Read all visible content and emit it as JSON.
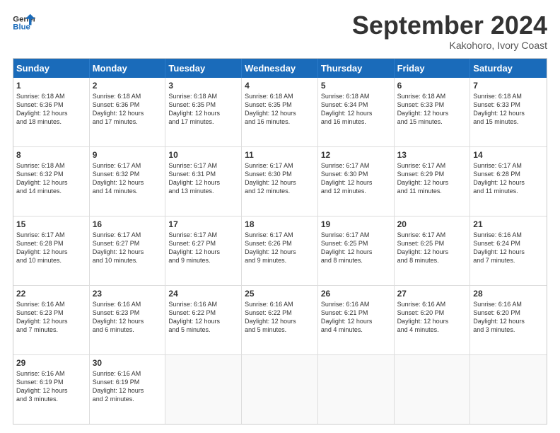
{
  "header": {
    "logo_line1": "General",
    "logo_line2": "Blue",
    "month": "September 2024",
    "location": "Kakohoro, Ivory Coast"
  },
  "weekdays": [
    "Sunday",
    "Monday",
    "Tuesday",
    "Wednesday",
    "Thursday",
    "Friday",
    "Saturday"
  ],
  "weeks": [
    [
      {
        "day": "1",
        "lines": [
          "Sunrise: 6:18 AM",
          "Sunset: 6:36 PM",
          "Daylight: 12 hours",
          "and 18 minutes."
        ]
      },
      {
        "day": "2",
        "lines": [
          "Sunrise: 6:18 AM",
          "Sunset: 6:36 PM",
          "Daylight: 12 hours",
          "and 17 minutes."
        ]
      },
      {
        "day": "3",
        "lines": [
          "Sunrise: 6:18 AM",
          "Sunset: 6:35 PM",
          "Daylight: 12 hours",
          "and 17 minutes."
        ]
      },
      {
        "day": "4",
        "lines": [
          "Sunrise: 6:18 AM",
          "Sunset: 6:35 PM",
          "Daylight: 12 hours",
          "and 16 minutes."
        ]
      },
      {
        "day": "5",
        "lines": [
          "Sunrise: 6:18 AM",
          "Sunset: 6:34 PM",
          "Daylight: 12 hours",
          "and 16 minutes."
        ]
      },
      {
        "day": "6",
        "lines": [
          "Sunrise: 6:18 AM",
          "Sunset: 6:33 PM",
          "Daylight: 12 hours",
          "and 15 minutes."
        ]
      },
      {
        "day": "7",
        "lines": [
          "Sunrise: 6:18 AM",
          "Sunset: 6:33 PM",
          "Daylight: 12 hours",
          "and 15 minutes."
        ]
      }
    ],
    [
      {
        "day": "8",
        "lines": [
          "Sunrise: 6:18 AM",
          "Sunset: 6:32 PM",
          "Daylight: 12 hours",
          "and 14 minutes."
        ]
      },
      {
        "day": "9",
        "lines": [
          "Sunrise: 6:17 AM",
          "Sunset: 6:32 PM",
          "Daylight: 12 hours",
          "and 14 minutes."
        ]
      },
      {
        "day": "10",
        "lines": [
          "Sunrise: 6:17 AM",
          "Sunset: 6:31 PM",
          "Daylight: 12 hours",
          "and 13 minutes."
        ]
      },
      {
        "day": "11",
        "lines": [
          "Sunrise: 6:17 AM",
          "Sunset: 6:30 PM",
          "Daylight: 12 hours",
          "and 12 minutes."
        ]
      },
      {
        "day": "12",
        "lines": [
          "Sunrise: 6:17 AM",
          "Sunset: 6:30 PM",
          "Daylight: 12 hours",
          "and 12 minutes."
        ]
      },
      {
        "day": "13",
        "lines": [
          "Sunrise: 6:17 AM",
          "Sunset: 6:29 PM",
          "Daylight: 12 hours",
          "and 11 minutes."
        ]
      },
      {
        "day": "14",
        "lines": [
          "Sunrise: 6:17 AM",
          "Sunset: 6:28 PM",
          "Daylight: 12 hours",
          "and 11 minutes."
        ]
      }
    ],
    [
      {
        "day": "15",
        "lines": [
          "Sunrise: 6:17 AM",
          "Sunset: 6:28 PM",
          "Daylight: 12 hours",
          "and 10 minutes."
        ]
      },
      {
        "day": "16",
        "lines": [
          "Sunrise: 6:17 AM",
          "Sunset: 6:27 PM",
          "Daylight: 12 hours",
          "and 10 minutes."
        ]
      },
      {
        "day": "17",
        "lines": [
          "Sunrise: 6:17 AM",
          "Sunset: 6:27 PM",
          "Daylight: 12 hours",
          "and 9 minutes."
        ]
      },
      {
        "day": "18",
        "lines": [
          "Sunrise: 6:17 AM",
          "Sunset: 6:26 PM",
          "Daylight: 12 hours",
          "and 9 minutes."
        ]
      },
      {
        "day": "19",
        "lines": [
          "Sunrise: 6:17 AM",
          "Sunset: 6:25 PM",
          "Daylight: 12 hours",
          "and 8 minutes."
        ]
      },
      {
        "day": "20",
        "lines": [
          "Sunrise: 6:17 AM",
          "Sunset: 6:25 PM",
          "Daylight: 12 hours",
          "and 8 minutes."
        ]
      },
      {
        "day": "21",
        "lines": [
          "Sunrise: 6:16 AM",
          "Sunset: 6:24 PM",
          "Daylight: 12 hours",
          "and 7 minutes."
        ]
      }
    ],
    [
      {
        "day": "22",
        "lines": [
          "Sunrise: 6:16 AM",
          "Sunset: 6:23 PM",
          "Daylight: 12 hours",
          "and 7 minutes."
        ]
      },
      {
        "day": "23",
        "lines": [
          "Sunrise: 6:16 AM",
          "Sunset: 6:23 PM",
          "Daylight: 12 hours",
          "and 6 minutes."
        ]
      },
      {
        "day": "24",
        "lines": [
          "Sunrise: 6:16 AM",
          "Sunset: 6:22 PM",
          "Daylight: 12 hours",
          "and 5 minutes."
        ]
      },
      {
        "day": "25",
        "lines": [
          "Sunrise: 6:16 AM",
          "Sunset: 6:22 PM",
          "Daylight: 12 hours",
          "and 5 minutes."
        ]
      },
      {
        "day": "26",
        "lines": [
          "Sunrise: 6:16 AM",
          "Sunset: 6:21 PM",
          "Daylight: 12 hours",
          "and 4 minutes."
        ]
      },
      {
        "day": "27",
        "lines": [
          "Sunrise: 6:16 AM",
          "Sunset: 6:20 PM",
          "Daylight: 12 hours",
          "and 4 minutes."
        ]
      },
      {
        "day": "28",
        "lines": [
          "Sunrise: 6:16 AM",
          "Sunset: 6:20 PM",
          "Daylight: 12 hours",
          "and 3 minutes."
        ]
      }
    ],
    [
      {
        "day": "29",
        "lines": [
          "Sunrise: 6:16 AM",
          "Sunset: 6:19 PM",
          "Daylight: 12 hours",
          "and 3 minutes."
        ]
      },
      {
        "day": "30",
        "lines": [
          "Sunrise: 6:16 AM",
          "Sunset: 6:19 PM",
          "Daylight: 12 hours",
          "and 2 minutes."
        ]
      },
      {
        "day": "",
        "lines": []
      },
      {
        "day": "",
        "lines": []
      },
      {
        "day": "",
        "lines": []
      },
      {
        "day": "",
        "lines": []
      },
      {
        "day": "",
        "lines": []
      }
    ]
  ]
}
